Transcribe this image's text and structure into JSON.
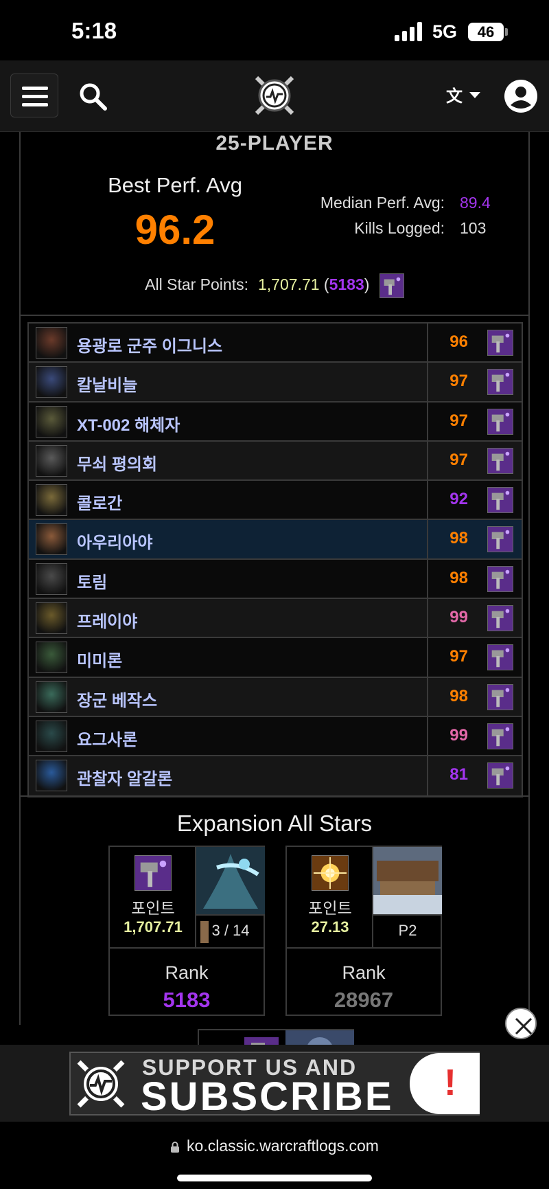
{
  "status_bar": {
    "time": "5:18",
    "network": "5G",
    "battery": "46"
  },
  "header": {
    "menu_icon": "hamburger-icon",
    "search_icon": "search-icon",
    "logo": "warcraftlogs-logo",
    "language_icon": "translate-icon",
    "profile_icon": "user-icon"
  },
  "summary": {
    "section_title": "25-PLAYER",
    "best_perf_label": "Best Perf. Avg",
    "best_perf_value": "96.2",
    "median_label": "Median Perf. Avg:",
    "median_value": "89.4",
    "kills_label": "Kills Logged:",
    "kills_value": "103",
    "allstar_label": "All Star Points:",
    "allstar_points": "1,707.71",
    "allstar_rank": "5183",
    "allstar_open": " (",
    "allstar_close": ")"
  },
  "bosses": [
    {
      "name": "용광로 군주 이그니스",
      "score": "96",
      "color": "#ff8000"
    },
    {
      "name": "칼날비늘",
      "score": "97",
      "color": "#ff8000"
    },
    {
      "name": "XT-002 해체자",
      "score": "97",
      "color": "#ff8000"
    },
    {
      "name": "무쇠 평의회",
      "score": "97",
      "color": "#ff8000"
    },
    {
      "name": "콜로간",
      "score": "92",
      "color": "#a335ee"
    },
    {
      "name": "아우리아야",
      "score": "98",
      "color": "#ff8000"
    },
    {
      "name": "토림",
      "score": "98",
      "color": "#ff8000"
    },
    {
      "name": "프레이야",
      "score": "99",
      "color": "#e268a8"
    },
    {
      "name": "미미론",
      "score": "97",
      "color": "#ff8000"
    },
    {
      "name": "장군 베작스",
      "score": "98",
      "color": "#ff8000"
    },
    {
      "name": "요그사론",
      "score": "99",
      "color": "#e268a8"
    },
    {
      "name": "관찰자 알갈론",
      "score": "81",
      "color": "#a335ee"
    }
  ],
  "expansion": {
    "title": "Expansion All Stars",
    "cards": [
      {
        "points_label": "포인트",
        "points_value": "1,707.71",
        "progress": "3 / 14",
        "rank_label": "Rank",
        "rank_value": "5183",
        "rank_color": "#a335ee"
      },
      {
        "points_label": "포인트",
        "points_value": "27.13",
        "progress": "P2",
        "rank_label": "Rank",
        "rank_value": "28967",
        "rank_color": "#777777"
      }
    ]
  },
  "ad": {
    "line1": "SUPPORT US AND",
    "line2": "SUBSCRIBE",
    "exclaim": "!"
  },
  "browser": {
    "url": "ko.classic.warcraftlogs.com"
  }
}
